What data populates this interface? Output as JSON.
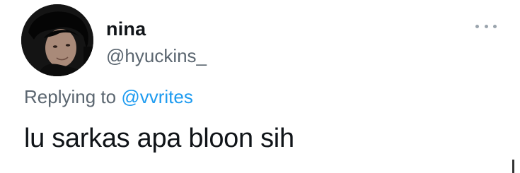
{
  "tweet": {
    "author": {
      "display_name": "nina",
      "handle": "@hyuckins_",
      "avatar_icon": "profile-photo"
    },
    "more_icon": "more-options-icon",
    "replying": {
      "prefix": "Replying to",
      "mention": "@vvrites"
    },
    "text": "lu sarkas apa bloon sih"
  },
  "colors": {
    "text": "#101418",
    "secondary": "#5b6670",
    "accent": "#1d9bf0"
  }
}
